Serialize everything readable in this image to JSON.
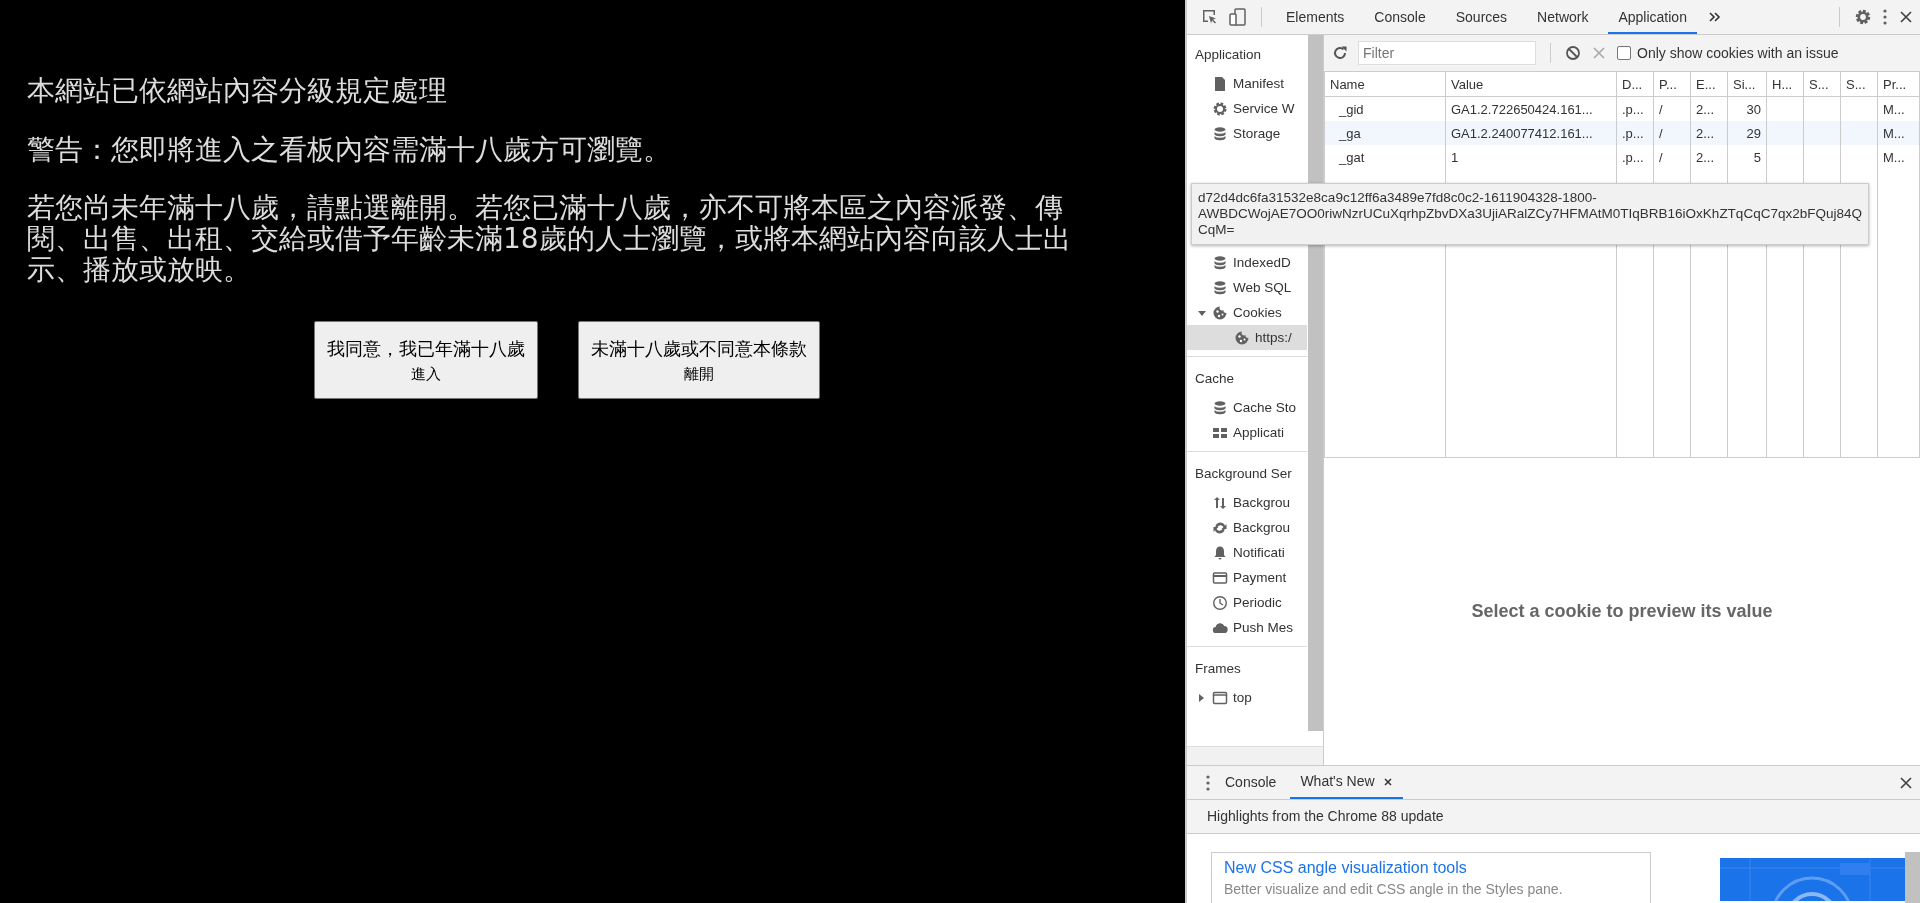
{
  "page": {
    "notices": [
      "本網站已依網站內容分級規定處理",
      "警告：您即將進入之看板內容需滿十八歲方可瀏覽。",
      "若您尚未年滿十八歲，請點選離開。若您已滿十八歲，亦不可將本區之內容派發、傳閱、出售、出租、交給或借予年齡未滿18歲的人士瀏覽，或將本網站內容向該人士出示、播放或放映。"
    ],
    "buttons": [
      {
        "label": "我同意，我已年滿十八歲",
        "sublabel": "進入"
      },
      {
        "label": "未滿十八歲或不同意本條款",
        "sublabel": "離開"
      }
    ]
  },
  "devtools": {
    "tabs": [
      {
        "label": "Elements",
        "selected": false
      },
      {
        "label": "Console",
        "selected": false
      },
      {
        "label": "Sources",
        "selected": false
      },
      {
        "label": "Network",
        "selected": false
      },
      {
        "label": "Application",
        "selected": true
      }
    ],
    "sidebar": [
      {
        "title": "Application",
        "items": [
          {
            "label": "Manifest",
            "kind": "file",
            "selected": false
          },
          {
            "label": "Service W",
            "kind": "gear",
            "selected": false
          },
          {
            "label": "Storage",
            "kind": "database",
            "selected": false
          }
        ]
      },
      {
        "items": [
          {
            "label": "IndexedD",
            "kind": "database",
            "selected": false
          },
          {
            "label": "Web SQL",
            "kind": "database",
            "selected": false
          },
          {
            "label": "Cookies",
            "kind": "cookie",
            "selected": false,
            "expanded": true,
            "children": [
              {
                "label": "https:/",
                "kind": "cookie",
                "selected": true
              }
            ]
          }
        ]
      },
      {
        "title": "Cache",
        "items": [
          {
            "label": "Cache Sto",
            "kind": "database",
            "selected": false
          },
          {
            "label": "Applicati",
            "kind": "grid",
            "selected": false
          }
        ]
      },
      {
        "title": "Background Ser",
        "items": [
          {
            "label": "Backgrou",
            "kind": "arrows",
            "selected": false
          },
          {
            "label": "Backgrou",
            "kind": "sync",
            "selected": false
          },
          {
            "label": "Notificati",
            "kind": "bell",
            "selected": false
          },
          {
            "label": "Payment",
            "kind": "card",
            "selected": false
          },
          {
            "label": "Periodic",
            "kind": "clock",
            "selected": false
          },
          {
            "label": "Push Mes",
            "kind": "cloud",
            "selected": false
          }
        ]
      },
      {
        "title": "Frames",
        "items": [
          {
            "label": "top",
            "kind": "frame",
            "selected": false,
            "expanded": false
          }
        ]
      }
    ],
    "filter": {
      "placeholder": "Filter"
    },
    "issue_filter": {
      "label": "Only show cookies with an issue",
      "checked": false
    },
    "table": {
      "columns": [
        "Name",
        "Value",
        "D...",
        "P...",
        "E...",
        "Si...",
        "H...",
        "S...",
        "S...",
        "Pr..."
      ],
      "rows": [
        {
          "cells": [
            "_gid",
            "GA1.2.722650424.161...",
            ".p...",
            "/",
            "2...",
            "30",
            "",
            "",
            "",
            "M..."
          ]
        },
        {
          "cells": [
            "_ga",
            "GA1.2.240077412.161...",
            ".p...",
            "/",
            "2...",
            "29",
            "",
            "",
            "",
            "M..."
          ]
        },
        {
          "cells": [
            "_gat",
            "1",
            ".p...",
            "/",
            "2...",
            "5",
            "",
            "",
            "",
            "M..."
          ]
        }
      ]
    },
    "tooltip": {
      "lines": [
        "d72d4dc6fa31532e8ca9c12ff6a3489e7fd8c0c2-1611904328-1800-",
        "AWBDCWojAE7OO0riwNzrUCuXqrhpZbvDXa3UjiARalZCy7HFMAtM0TIqBRB16iOxKhZTqCqC7qx2bFQuj84Q",
        "CqM="
      ]
    },
    "preview": {
      "message": "Select a cookie to preview its value"
    },
    "drawer": {
      "tabs": [
        {
          "label": "Console",
          "selected": false,
          "closable": false
        },
        {
          "label": "What's New",
          "selected": true,
          "closable": true
        }
      ],
      "heading": "Highlights from the Chrome 88 update",
      "cards": [
        {
          "title": "New CSS angle visualization tools",
          "description": "Better visualize and edit CSS angle in the Styles pane."
        }
      ]
    }
  }
}
